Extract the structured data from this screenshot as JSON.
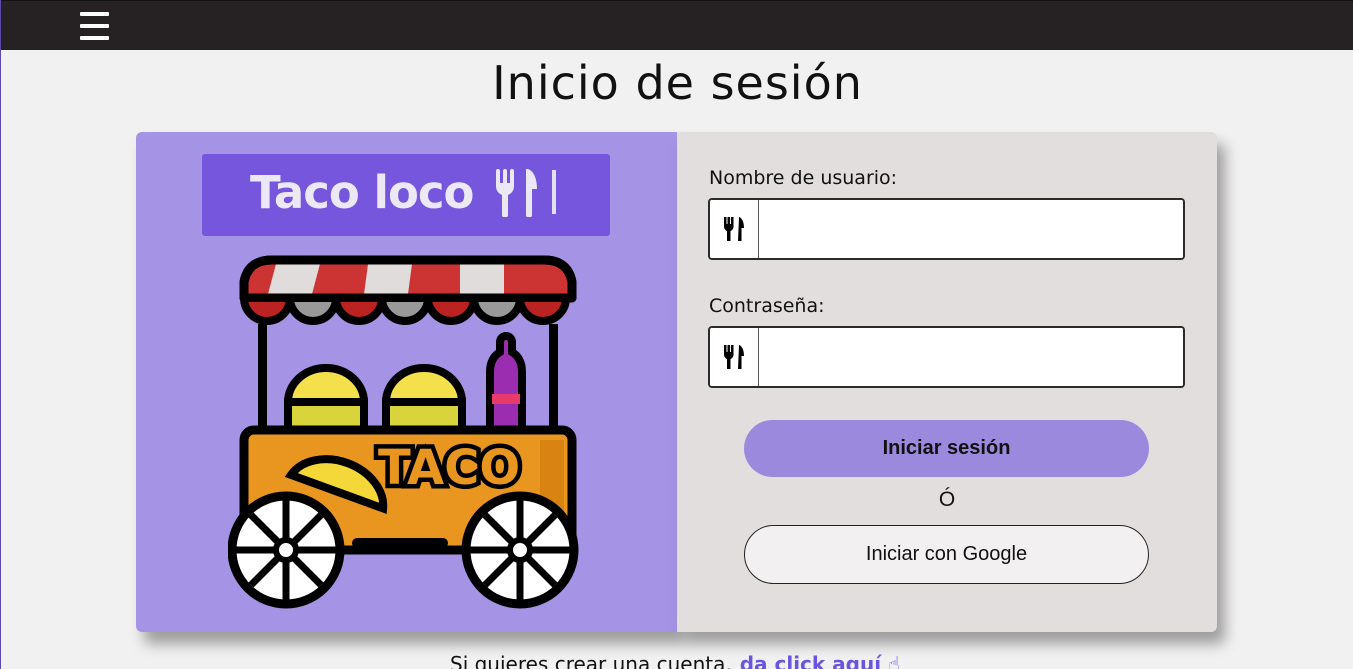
{
  "nav": {
    "menu_icon": "hamburger-menu-icon"
  },
  "page": {
    "title": "Inicio de sesión"
  },
  "brand": {
    "name": "Taco loco",
    "icon": "utensils-icon",
    "illustration": "taco-cart-illustration"
  },
  "illustration": {
    "sign_text": "TACO"
  },
  "form": {
    "username_label": "Nombre de usuario:",
    "username_value": "",
    "username_icon": "utensils-icon",
    "password_label": "Contraseña:",
    "password_value": "",
    "password_icon": "utensils-icon",
    "login_button": "Iniciar sesión",
    "or_separator": "Ó",
    "google_button": "Iniciar con Google"
  },
  "signup": {
    "prompt": "Si quieres crear una cuenta,",
    "link": "da click aquí",
    "link_icon": "pointing-hand-icon"
  },
  "colors": {
    "topbar": "#262223",
    "left_panel": "#a594e5",
    "brand_box": "#7556dc",
    "right_panel": "#e3dede",
    "login_button": "#9b89de",
    "link": "#6a55e0"
  }
}
